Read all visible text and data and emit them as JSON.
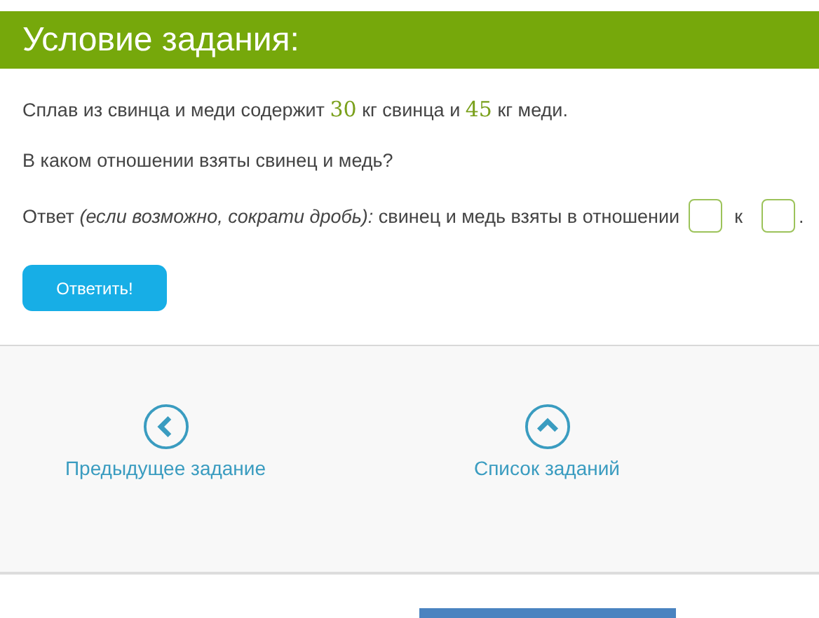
{
  "header": {
    "title": "Условие задания:"
  },
  "problem": {
    "segments": [
      {
        "kind": "text",
        "text": "Сплав из свинца и меди содержит "
      },
      {
        "kind": "number",
        "text": "30"
      },
      {
        "kind": "text",
        "text": " кг свинца и "
      },
      {
        "kind": "number",
        "text": "45"
      },
      {
        "kind": "text",
        "text": " кг меди."
      }
    ]
  },
  "question": "В каком отношении взяты свинец и медь?",
  "answer": {
    "prompt": "Ответ *(если возможно, сократи дробь):* свинец и медь взяты в отношении",
    "separator": "к",
    "ending": "."
  },
  "submit_button": "Ответить!",
  "nav": [
    {
      "kind": "previous",
      "label": "Предыдущее задание"
    },
    {
      "kind": "list",
      "label": "Список заданий"
    }
  ]
}
